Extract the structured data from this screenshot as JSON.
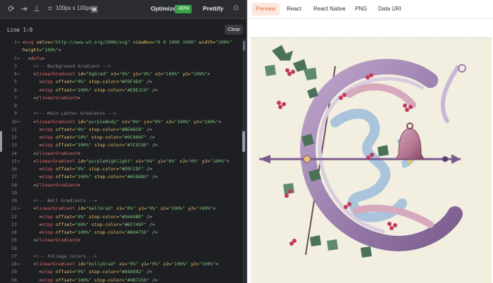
{
  "toolbar": {
    "size_label": "100px x 100px",
    "optimize_label": "Optimize",
    "optimize_badge": "-80%",
    "prettify_label": "Prettify",
    "icons": [
      "refresh-icon",
      "export-icon",
      "align-icon",
      "crop-icon",
      "frame-icon",
      "settings-icon"
    ]
  },
  "editor": {
    "status": "Line 1:0",
    "clear_label": "Clear",
    "lines": [
      {
        "n": "1",
        "fold": "▾",
        "parts": [
          [
            "pun",
            "<"
          ],
          [
            "tag",
            "svg"
          ],
          [
            "pun",
            " "
          ],
          [
            "attr",
            "xmlns="
          ],
          [
            "str",
            "\"http://www.w3.org/2000/svg\""
          ],
          [
            "pun",
            " "
          ],
          [
            "attr",
            "viewBox="
          ],
          [
            "str",
            "\"0 0 1000 1000\""
          ],
          [
            "pun",
            " "
          ],
          [
            "attr",
            "width="
          ],
          [
            "str",
            "\"100%\""
          ]
        ]
      },
      {
        "n": "",
        "fold": "",
        "parts": [
          [
            "attr",
            "height="
          ],
          [
            "str",
            "\"100%\""
          ],
          [
            "pun",
            ">"
          ]
        ]
      },
      {
        "n": "2",
        "fold": "▾",
        "parts": [
          [
            "pun",
            "  <"
          ],
          [
            "tag",
            "defs"
          ],
          [
            "pun",
            ">"
          ]
        ]
      },
      {
        "n": "3",
        "fold": "",
        "parts": [
          [
            "com",
            "    <!-- Background Gradient -->"
          ]
        ]
      },
      {
        "n": "4",
        "fold": "▾",
        "parts": [
          [
            "pun",
            "    <"
          ],
          [
            "tag",
            "linearGradient"
          ],
          [
            "pun",
            " "
          ],
          [
            "attr",
            "id="
          ],
          [
            "str",
            "\"bgGrad\""
          ],
          [
            "pun",
            " "
          ],
          [
            "attr",
            "x1="
          ],
          [
            "str",
            "\"0%\""
          ],
          [
            "pun",
            " "
          ],
          [
            "attr",
            "y1="
          ],
          [
            "str",
            "\"0%\""
          ],
          [
            "pun",
            " "
          ],
          [
            "attr",
            "x2="
          ],
          [
            "str",
            "\"100%\""
          ],
          [
            "pun",
            " "
          ],
          [
            "attr",
            "y2="
          ],
          [
            "str",
            "\"100%\""
          ],
          [
            "pun",
            ">"
          ]
        ]
      },
      {
        "n": "5",
        "fold": "",
        "parts": [
          [
            "pun",
            "      <"
          ],
          [
            "tag",
            "stop"
          ],
          [
            "pun",
            " "
          ],
          [
            "attr",
            "offset="
          ],
          [
            "str",
            "\"0%\""
          ],
          [
            "pun",
            " "
          ],
          [
            "attr",
            "stop-color="
          ],
          [
            "str",
            "\"#F6F3E6\""
          ],
          [
            "pun",
            " />"
          ]
        ]
      },
      {
        "n": "6",
        "fold": "",
        "parts": [
          [
            "pun",
            "      <"
          ],
          [
            "tag",
            "stop"
          ],
          [
            "pun",
            " "
          ],
          [
            "attr",
            "offset="
          ],
          [
            "str",
            "\"100%\""
          ],
          [
            "pun",
            " "
          ],
          [
            "attr",
            "stop-color="
          ],
          [
            "str",
            "\"#E8E2C8\""
          ],
          [
            "pun",
            " />"
          ]
        ]
      },
      {
        "n": "7",
        "fold": "",
        "parts": [
          [
            "pun",
            "    </"
          ],
          [
            "tag",
            "linearGradient"
          ],
          [
            "pun",
            ">"
          ]
        ]
      },
      {
        "n": "8",
        "fold": "",
        "parts": []
      },
      {
        "n": "9",
        "fold": "",
        "parts": [
          [
            "com",
            "    <!-- Main Letter Gradients -->"
          ]
        ]
      },
      {
        "n": "10",
        "fold": "▾",
        "parts": [
          [
            "pun",
            "    <"
          ],
          [
            "tag",
            "linearGradient"
          ],
          [
            "pun",
            " "
          ],
          [
            "attr",
            "id="
          ],
          [
            "str",
            "\"purpleBody\""
          ],
          [
            "pun",
            " "
          ],
          [
            "attr",
            "x1="
          ],
          [
            "str",
            "\"0%\""
          ],
          [
            "pun",
            " "
          ],
          [
            "attr",
            "y1="
          ],
          [
            "str",
            "\"0%\""
          ],
          [
            "pun",
            " "
          ],
          [
            "attr",
            "x2="
          ],
          [
            "str",
            "\"100%\""
          ],
          [
            "pun",
            " "
          ],
          [
            "attr",
            "y2="
          ],
          [
            "str",
            "\"100%\""
          ],
          [
            "pun",
            ">"
          ]
        ]
      },
      {
        "n": "11",
        "fold": "",
        "parts": [
          [
            "pun",
            "      <"
          ],
          [
            "tag",
            "stop"
          ],
          [
            "pun",
            " "
          ],
          [
            "attr",
            "offset="
          ],
          [
            "str",
            "\"0%\""
          ],
          [
            "pun",
            " "
          ],
          [
            "attr",
            "stop-color="
          ],
          [
            "str",
            "\"#BEA6CB\""
          ],
          [
            "pun",
            " />"
          ]
        ]
      },
      {
        "n": "12",
        "fold": "",
        "parts": [
          [
            "pun",
            "      <"
          ],
          [
            "tag",
            "stop"
          ],
          [
            "pun",
            " "
          ],
          [
            "attr",
            "offset="
          ],
          [
            "str",
            "\"50%\""
          ],
          [
            "pun",
            " "
          ],
          [
            "attr",
            "stop-color="
          ],
          [
            "str",
            "\"#9C80AF\""
          ],
          [
            "pun",
            " />"
          ]
        ]
      },
      {
        "n": "13",
        "fold": "",
        "parts": [
          [
            "pun",
            "      <"
          ],
          [
            "tag",
            "stop"
          ],
          [
            "pun",
            " "
          ],
          [
            "attr",
            "offset="
          ],
          [
            "str",
            "\"100%\""
          ],
          [
            "pun",
            " "
          ],
          [
            "attr",
            "stop-color="
          ],
          [
            "str",
            "\"#7C5C8E\""
          ],
          [
            "pun",
            " />"
          ]
        ]
      },
      {
        "n": "14",
        "fold": "",
        "parts": [
          [
            "pun",
            "    </"
          ],
          [
            "tag",
            "linearGradient"
          ],
          [
            "pun",
            ">"
          ]
        ]
      },
      {
        "n": "15",
        "fold": "▾",
        "parts": [
          [
            "pun",
            "    <"
          ],
          [
            "tag",
            "linearGradient"
          ],
          [
            "pun",
            " "
          ],
          [
            "attr",
            "id="
          ],
          [
            "str",
            "\"purpleHighlight\""
          ],
          [
            "pun",
            " "
          ],
          [
            "attr",
            "x1="
          ],
          [
            "str",
            "\"0%\""
          ],
          [
            "pun",
            " "
          ],
          [
            "attr",
            "y1="
          ],
          [
            "str",
            "\"0%\""
          ],
          [
            "pun",
            " "
          ],
          [
            "attr",
            "x2="
          ],
          [
            "str",
            "\"0%\""
          ],
          [
            "pun",
            " "
          ],
          [
            "attr",
            "y2="
          ],
          [
            "str",
            "\"100%\""
          ],
          [
            "pun",
            ">"
          ]
        ]
      },
      {
        "n": "16",
        "fold": "",
        "parts": [
          [
            "pun",
            "      <"
          ],
          [
            "tag",
            "stop"
          ],
          [
            "pun",
            " "
          ],
          [
            "attr",
            "offset="
          ],
          [
            "str",
            "\"0%\""
          ],
          [
            "pun",
            " "
          ],
          [
            "attr",
            "stop-color="
          ],
          [
            "str",
            "\"#D9CCDF\""
          ],
          [
            "pun",
            " />"
          ]
        ]
      },
      {
        "n": "17",
        "fold": "",
        "parts": [
          [
            "pun",
            "      <"
          ],
          [
            "tag",
            "stop"
          ],
          [
            "pun",
            " "
          ],
          [
            "attr",
            "offset="
          ],
          [
            "str",
            "\"100%\""
          ],
          [
            "pun",
            " "
          ],
          [
            "attr",
            "stop-color="
          ],
          [
            "str",
            "\"#A58AB3\""
          ],
          [
            "pun",
            " />"
          ]
        ]
      },
      {
        "n": "18",
        "fold": "",
        "parts": [
          [
            "pun",
            "    </"
          ],
          [
            "tag",
            "linearGradient"
          ],
          [
            "pun",
            ">"
          ]
        ]
      },
      {
        "n": "19",
        "fold": "",
        "parts": []
      },
      {
        "n": "20",
        "fold": "",
        "parts": [
          [
            "com",
            "    <!-- Bell Gradients -->"
          ]
        ]
      },
      {
        "n": "21",
        "fold": "▾",
        "parts": [
          [
            "pun",
            "    <"
          ],
          [
            "tag",
            "linearGradient"
          ],
          [
            "pun",
            " "
          ],
          [
            "attr",
            "id="
          ],
          [
            "str",
            "\"bellGrad\""
          ],
          [
            "pun",
            " "
          ],
          [
            "attr",
            "x1="
          ],
          [
            "str",
            "\"0%\""
          ],
          [
            "pun",
            " "
          ],
          [
            "attr",
            "y1="
          ],
          [
            "str",
            "\"0%\""
          ],
          [
            "pun",
            " "
          ],
          [
            "attr",
            "x2="
          ],
          [
            "str",
            "\"100%\""
          ],
          [
            "pun",
            " "
          ],
          [
            "attr",
            "y2="
          ],
          [
            "str",
            "\"100%\""
          ],
          [
            "pun",
            ">"
          ]
        ]
      },
      {
        "n": "22",
        "fold": "",
        "parts": [
          [
            "pun",
            "      <"
          ],
          [
            "tag",
            "stop"
          ],
          [
            "pun",
            " "
          ],
          [
            "attr",
            "offset="
          ],
          [
            "str",
            "\"0%\""
          ],
          [
            "pun",
            " "
          ],
          [
            "attr",
            "stop-color="
          ],
          [
            "str",
            "\"#D6A9BD\""
          ],
          [
            "pun",
            " />"
          ]
        ]
      },
      {
        "n": "23",
        "fold": "",
        "parts": [
          [
            "pun",
            "      <"
          ],
          [
            "tag",
            "stop"
          ],
          [
            "pun",
            " "
          ],
          [
            "attr",
            "offset="
          ],
          [
            "str",
            "\"60%\""
          ],
          [
            "pun",
            " "
          ],
          [
            "attr",
            "stop-color="
          ],
          [
            "str",
            "\"#B2748F\""
          ],
          [
            "pun",
            " />"
          ]
        ]
      },
      {
        "n": "24",
        "fold": "",
        "parts": [
          [
            "pun",
            "      <"
          ],
          [
            "tag",
            "stop"
          ],
          [
            "pun",
            " "
          ],
          [
            "attr",
            "offset="
          ],
          [
            "str",
            "\"100%\""
          ],
          [
            "pun",
            " "
          ],
          [
            "attr",
            "stop-color="
          ],
          [
            "str",
            "\"#80475E\""
          ],
          [
            "pun",
            " />"
          ]
        ]
      },
      {
        "n": "25",
        "fold": "",
        "parts": [
          [
            "pun",
            "    </"
          ],
          [
            "tag",
            "linearGradient"
          ],
          [
            "pun",
            ">"
          ]
        ]
      },
      {
        "n": "26",
        "fold": "",
        "parts": []
      },
      {
        "n": "27",
        "fold": "",
        "parts": [
          [
            "com",
            "    <!-- Foliage Colors -->"
          ]
        ]
      },
      {
        "n": "28",
        "fold": "▾",
        "parts": [
          [
            "pun",
            "    <"
          ],
          [
            "tag",
            "linearGradient"
          ],
          [
            "pun",
            " "
          ],
          [
            "attr",
            "id="
          ],
          [
            "str",
            "\"hollyGrad\""
          ],
          [
            "pun",
            " "
          ],
          [
            "attr",
            "x1="
          ],
          [
            "str",
            "\"0%\""
          ],
          [
            "pun",
            " "
          ],
          [
            "attr",
            "y1="
          ],
          [
            "str",
            "\"0%\""
          ],
          [
            "pun",
            " "
          ],
          [
            "attr",
            "x2="
          ],
          [
            "str",
            "\"100%\""
          ],
          [
            "pun",
            " "
          ],
          [
            "attr",
            "y2="
          ],
          [
            "str",
            "\"100%\""
          ],
          [
            "pun",
            ">"
          ]
        ]
      },
      {
        "n": "29",
        "fold": "",
        "parts": [
          [
            "pun",
            "      <"
          ],
          [
            "tag",
            "stop"
          ],
          [
            "pun",
            " "
          ],
          [
            "attr",
            "offset="
          ],
          [
            "str",
            "\"0%\""
          ],
          [
            "pun",
            " "
          ],
          [
            "attr",
            "stop-color="
          ],
          [
            "str",
            "\"#84A992\""
          ],
          [
            "pun",
            " />"
          ]
        ]
      },
      {
        "n": "30",
        "fold": "",
        "parts": [
          [
            "pun",
            "      <"
          ],
          [
            "tag",
            "stop"
          ],
          [
            "pun",
            " "
          ],
          [
            "attr",
            "offset="
          ],
          [
            "str",
            "\"100%\""
          ],
          [
            "pun",
            " "
          ],
          [
            "attr",
            "stop-color="
          ],
          [
            "str",
            "\"#4B7258\""
          ],
          [
            "pun",
            " />"
          ]
        ]
      }
    ]
  },
  "preview_tabs": [
    {
      "label": "Preview",
      "active": true
    },
    {
      "label": "React",
      "active": false
    },
    {
      "label": "React Native",
      "active": false
    },
    {
      "label": "PNG",
      "active": false
    },
    {
      "label": "Data URI",
      "active": false
    }
  ],
  "colors": {
    "accent": "#e46a3c",
    "optimize_badge": "#3aa14a",
    "editor_bg": "#1e1f22",
    "letter_purple": "#9C80AF",
    "ribbon_blue": "#A9C4DC",
    "holly_green": "#4B7258",
    "berry_red": "#C0395A"
  }
}
